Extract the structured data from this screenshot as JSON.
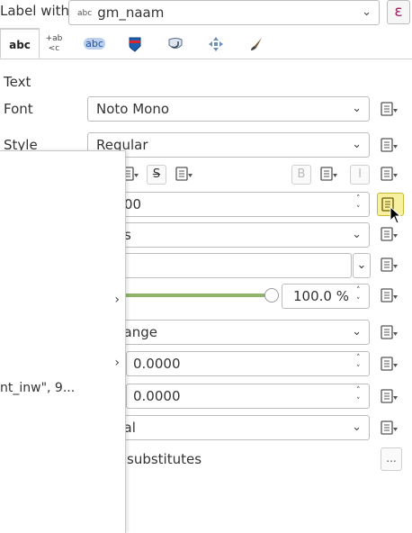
{
  "header": {
    "label_with": "Label with",
    "field_type_badge": "abc",
    "field_value": "gm_naam",
    "expression_button": "ε"
  },
  "tabs": [
    {
      "label": "abc",
      "icon": "text-tab"
    },
    {
      "label": "+ab/<c",
      "icon": "formatting-tab-icon"
    },
    {
      "label": "abc",
      "icon": "buffer-tab-icon"
    },
    {
      "label": "",
      "icon": "background-tab-icon"
    },
    {
      "label": "",
      "icon": "shadow-tab-icon"
    },
    {
      "label": "",
      "icon": "placement-tab-icon"
    },
    {
      "label": "",
      "icon": "rendering-tab-icon"
    }
  ],
  "text_section": {
    "heading": "Text",
    "font_label": "Font",
    "font_value": "Noto Mono",
    "style_label": "Style",
    "style_value": "Regular",
    "strike_glyph": "S",
    "bold_glyph": "B",
    "italic_glyph": "I",
    "size_value": "00",
    "unit_value": "s",
    "opacity_value": "100.0 %",
    "blend_value": "hange",
    "spacing_letter": "0.0000",
    "spacing_word": "0.0000",
    "case_value": "nal",
    "substitutes_label": "substitutes",
    "more_button": "..."
  },
  "popup": {
    "truncated_text": "nt_inw\", 9..."
  },
  "colors": {
    "accent_green": "#8fb36a",
    "highlight_yellow": "#f7f0a0",
    "expression_color": "#a02060"
  }
}
